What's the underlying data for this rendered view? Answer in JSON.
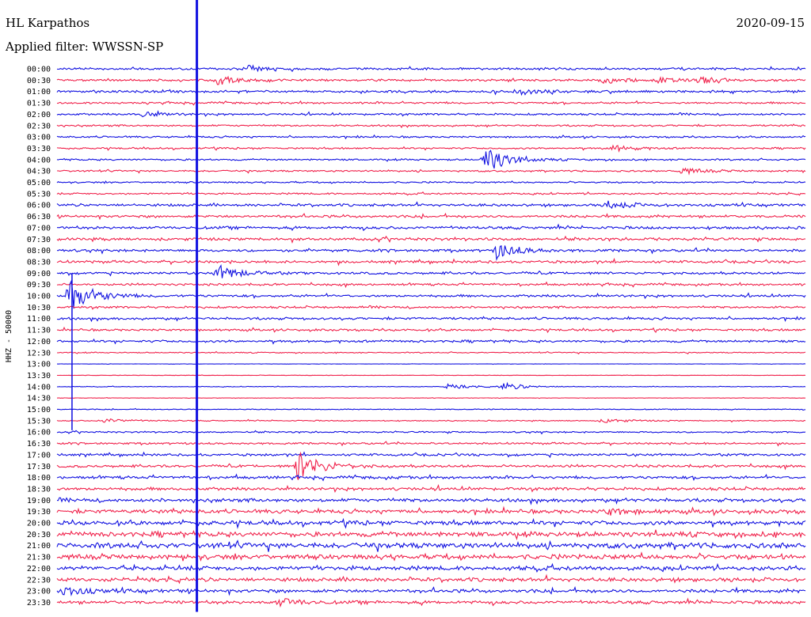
{
  "header": {
    "station": "HL Karpathos",
    "filter": "Applied filter: WWSSN-SP",
    "date": "2020-09-15"
  },
  "chart_data": {
    "type": "line",
    "title": "HL Karpathos",
    "ylabel": "HHZ - 50000",
    "row_labels": [
      "00:00",
      "00:30",
      "01:00",
      "01:30",
      "02:00",
      "02:30",
      "03:00",
      "03:30",
      "04:00",
      "04:30",
      "05:00",
      "05:30",
      "06:00",
      "06:30",
      "07:00",
      "07:30",
      "08:00",
      "08:30",
      "09:00",
      "09:30",
      "10:00",
      "10:30",
      "11:00",
      "11:30",
      "12:00",
      "12:30",
      "13:00",
      "13:30",
      "14:00",
      "14:30",
      "15:00",
      "15:30",
      "16:00",
      "16:30",
      "17:00",
      "17:30",
      "18:00",
      "18:30",
      "19:00",
      "19:30",
      "20:00",
      "20:30",
      "21:00",
      "21:30",
      "22:00",
      "22:30",
      "23:00",
      "23:30"
    ],
    "row_colors": [
      "#1010e0",
      "#f0204a"
    ],
    "noise_level": [
      1.0,
      1.0,
      1.1,
      0.9,
      0.9,
      0.8,
      0.8,
      0.8,
      0.8,
      0.8,
      0.7,
      0.8,
      1.2,
      1.2,
      1.3,
      1.3,
      1.2,
      1.2,
      1.1,
      1.0,
      1.1,
      1.0,
      1.1,
      1.0,
      1.1,
      0.5,
      0.15,
      0.2,
      0.3,
      0.2,
      0.4,
      0.5,
      0.7,
      0.9,
      1.1,
      1.2,
      1.3,
      1.4,
      1.6,
      1.8,
      2.0,
      2.3,
      2.6,
      2.2,
      2.0,
      1.8,
      1.6,
      1.5
    ],
    "events": [
      {
        "row": 0,
        "x_min": 7.5,
        "amplitude": 4
      },
      {
        "row": 1,
        "x_min": 6.4,
        "amplitude": 5
      },
      {
        "row": 1,
        "x_min": 21.8,
        "amplitude": 4
      },
      {
        "row": 1,
        "x_min": 24.0,
        "amplitude": 3
      },
      {
        "row": 1,
        "x_min": 25.7,
        "amplitude": 4
      },
      {
        "row": 2,
        "x_min": 18.4,
        "amplitude": 4
      },
      {
        "row": 4,
        "x_min": 3.4,
        "amplitude": 3
      },
      {
        "row": 7,
        "x_min": 22.2,
        "amplitude": 4
      },
      {
        "row": 8,
        "x_min": 17.1,
        "amplitude": 18
      },
      {
        "row": 9,
        "x_min": 24.9,
        "amplitude": 4
      },
      {
        "row": 12,
        "x_min": 22.0,
        "amplitude": 5
      },
      {
        "row": 16,
        "x_min": 17.6,
        "amplitude": 10
      },
      {
        "row": 18,
        "x_min": 6.4,
        "amplitude": 10
      },
      {
        "row": 20,
        "x_min": 0.5,
        "amplitude": 22
      },
      {
        "row": 28,
        "x_min": 17.8,
        "amplitude": 5
      },
      {
        "row": 28,
        "x_min": 15.6,
        "amplitude": 3
      },
      {
        "row": 31,
        "x_min": 21.8,
        "amplitude": 3
      },
      {
        "row": 31,
        "x_min": 1.8,
        "amplitude": 3
      },
      {
        "row": 35,
        "x_min": 9.6,
        "amplitude": 20
      },
      {
        "row": 39,
        "x_min": 22.0,
        "amplitude": 4
      },
      {
        "row": 46,
        "x_min": 0.2,
        "amplitude": 6
      },
      {
        "row": 47,
        "x_min": 8.9,
        "amplitude": 5
      }
    ],
    "vertical_spikes": [
      {
        "x_min": 5.6,
        "from_row": 0,
        "to_row": 47,
        "color": "#1010e0"
      },
      {
        "x_min": 0.6,
        "from_row": 18,
        "to_row": 31,
        "color": "#1010e0"
      }
    ],
    "x_minutes": 30,
    "grid": false
  }
}
